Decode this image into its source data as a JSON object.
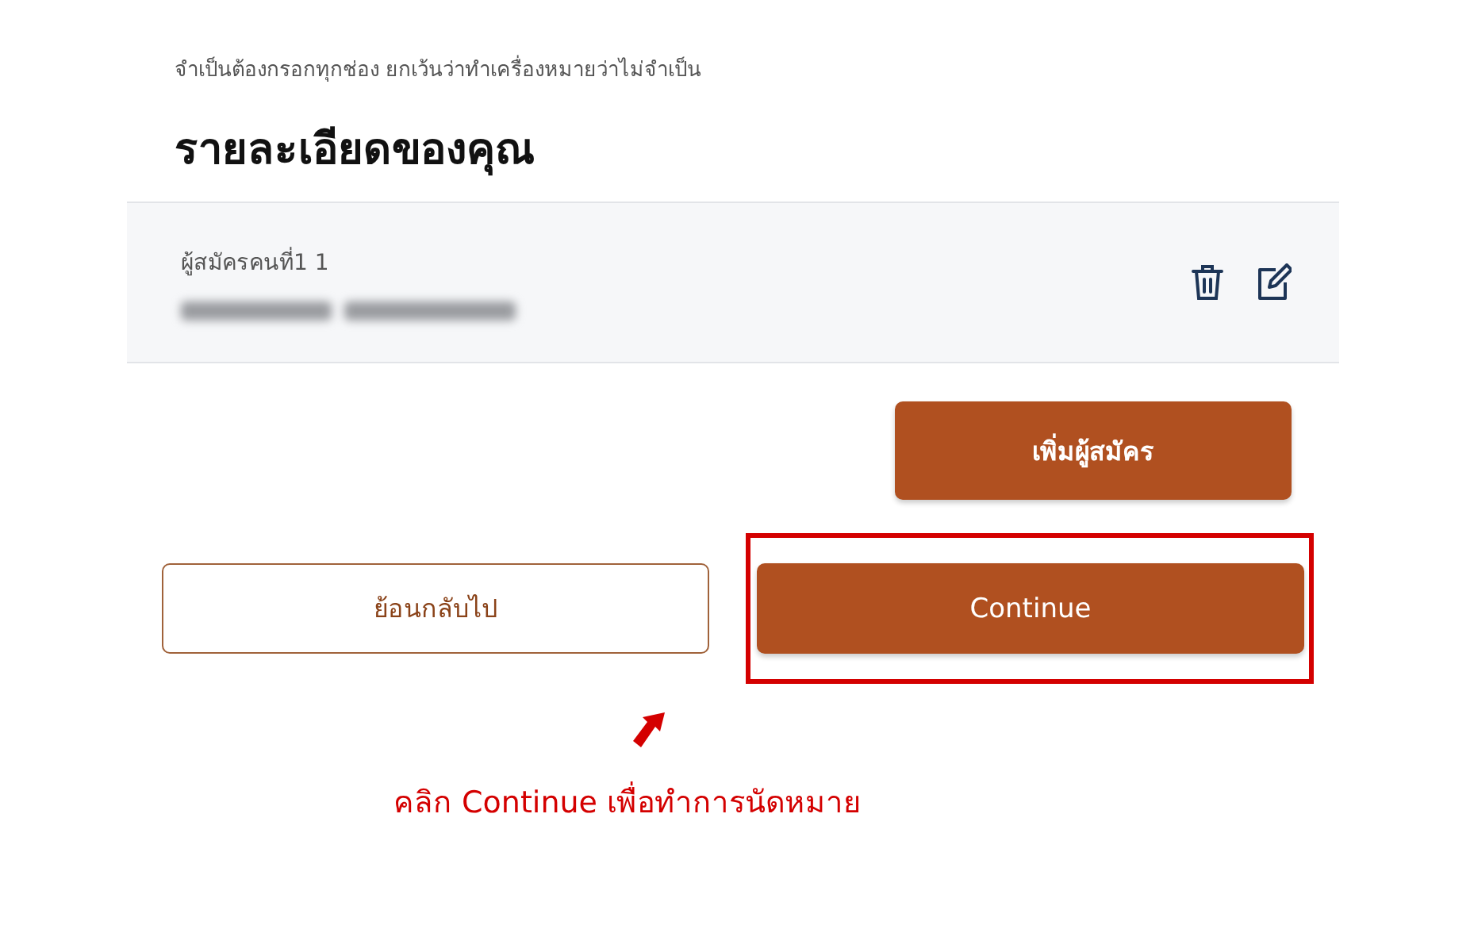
{
  "notice": "จำเป็นต้องกรอกทุกช่อง ยกเว้นว่าทำเครื่องหมายว่าไม่จำเป็น",
  "heading": "รายละเอียดของคุณ",
  "applicants": [
    {
      "label": "ผู้สมัครคนที่1 1"
    }
  ],
  "add_button": "เพิ่มผู้สมัคร",
  "back_button": "ย้อนกลับไป",
  "continue_button": "Continue",
  "annotation": "คลิก Continue เพื่อทำการนัดหมาย"
}
